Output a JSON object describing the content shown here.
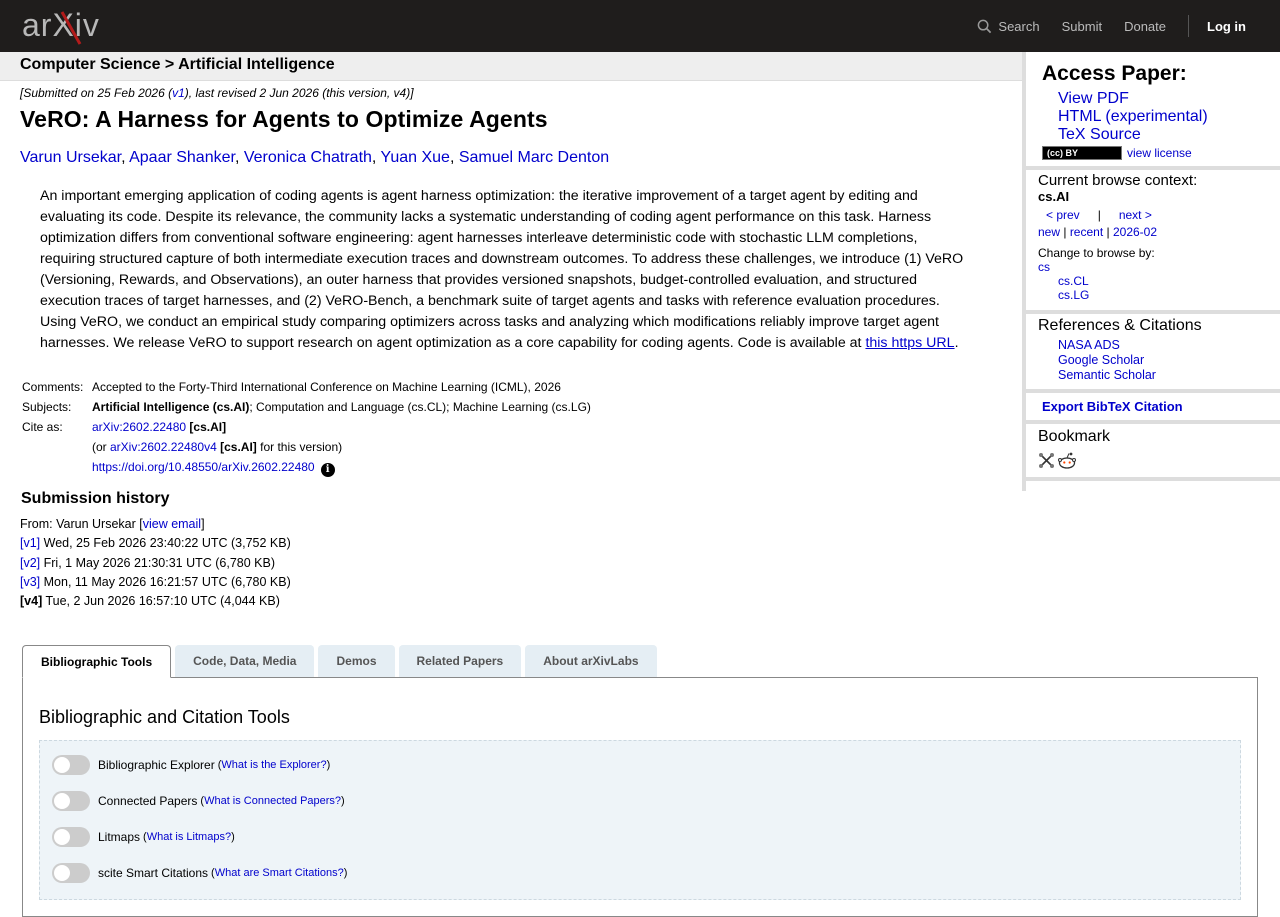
{
  "header": {
    "logo_text": "arXiv",
    "nav": {
      "search": "Search",
      "submit": "Submit",
      "donate": "Donate",
      "login": "Log in"
    }
  },
  "breadcrumb": "Computer Science > Artificial Intelligence",
  "paper": {
    "dateline_prefix": "[Submitted on 25 Feb 2026 (",
    "dateline_v1": "v1",
    "dateline_suffix": "), last revised 2 Jun 2026 (this version, v4)]",
    "title": "VeRO: A Harness for Agents to Optimize Agents",
    "authors": [
      "Varun Ursekar",
      "Apaar Shanker",
      "Veronica Chatrath",
      "Yuan Xue",
      "Samuel Marc Denton"
    ],
    "abstract_text": "An important emerging application of coding agents is agent harness optimization: the iterative improvement of a target agent by editing and evaluating its code. Despite its relevance, the community lacks a systematic understanding of coding agent performance on this task. Harness optimization differs from conventional software engineering: agent harnesses interleave deterministic code with stochastic LLM completions, requiring structured capture of both intermediate execution traces and downstream outcomes. To address these challenges, we introduce (1) VeRO (Versioning, Rewards, and Observations), an outer harness that provides versioned snapshots, budget-controlled evaluation, and structured execution traces of target harnesses, and (2) VeRO-Bench, a benchmark suite of target agents and tasks with reference evaluation procedures. Using VeRO, we conduct an empirical study comparing optimizers across tasks and analyzing which modifications reliably improve target agent harnesses. We release VeRO to support research on agent optimization as a core capability for coding agents. Code is available at ",
    "abstract_link": "this https URL",
    "abstract_end": "."
  },
  "metadata": {
    "comments_label": "Comments:",
    "comments": "Accepted to the Forty-Third International Conference on Machine Learning (ICML), 2026",
    "subjects_label": "Subjects:",
    "subjects_primary": "Artificial Intelligence (cs.AI)",
    "subjects_rest": "; Computation and Language (cs.CL); Machine Learning (cs.LG)",
    "cite_label": "Cite as:",
    "cite_id": "arXiv:2602.22480",
    "cite_cat": "[cs.AI]",
    "cite_or": "(or ",
    "cite_version_id": "arXiv:2602.22480v4",
    "cite_version_cat": "[cs.AI]",
    "cite_version_suffix": " for this version)",
    "doi": "https://doi.org/10.48550/arXiv.2602.22480"
  },
  "submission_history": {
    "title": "Submission history",
    "from_prefix": "From: Varun Ursekar [",
    "view_email": "view email",
    "from_suffix": "]",
    "versions": [
      {
        "tag": "[v1]",
        "detail": " Wed, 25 Feb 2026 23:40:22 UTC (3,752 KB)"
      },
      {
        "tag": "[v2]",
        "detail": " Fri, 1 May 2026 21:30:31 UTC (6,780 KB)"
      },
      {
        "tag": "[v3]",
        "detail": " Mon, 11 May 2026 16:21:57 UTC (6,780 KB)"
      },
      {
        "tag": "[v4]",
        "detail": " Tue, 2 Jun 2026 16:57:10 UTC (4,044 KB)"
      }
    ]
  },
  "tabs": [
    "Bibliographic Tools",
    "Code, Data, Media",
    "Demos",
    "Related Papers",
    "About arXivLabs"
  ],
  "panel": {
    "title": "Bibliographic and Citation Tools",
    "toggles": [
      {
        "label": "Bibliographic Explorer",
        "help": "What is the Explorer?"
      },
      {
        "label": "Connected Papers",
        "help": "What is Connected Papers?"
      },
      {
        "label": "Litmaps",
        "help": "What is Litmaps?"
      },
      {
        "label": "scite Smart Citations",
        "help": "What are Smart Citations?"
      }
    ]
  },
  "sidebar": {
    "access_title": "Access Paper:",
    "access_links": [
      "View PDF",
      "HTML (experimental)",
      "TeX Source"
    ],
    "license_badge": "(cc) BY",
    "view_license": "view license",
    "context_title": "Current browse context:",
    "context_current": "cs.AI",
    "prev": "< prev",
    "sep": "|",
    "next": "next >",
    "new": "new",
    "recent": "recent",
    "month": "2026-02",
    "change_title": "Change to browse by:",
    "browse_cs": "cs",
    "browse_sub": [
      "cs.CL",
      "cs.LG"
    ],
    "refs_title": "References & Citations",
    "refs_links": [
      "NASA ADS",
      "Google Scholar",
      "Semantic Scholar"
    ],
    "bibtex": "Export BibTeX Citation",
    "bookmark_title": "Bookmark"
  },
  "colors": {
    "header_bg": "#1f1d1c",
    "link": "#0000cc",
    "logo_red": "#b31b1b",
    "panel_bg": "#eef4f8"
  }
}
